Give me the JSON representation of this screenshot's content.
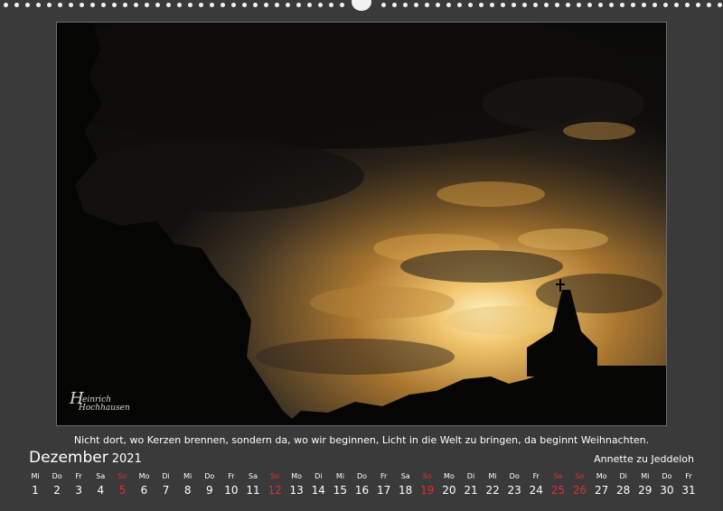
{
  "calendar": {
    "month_name": "Dezember",
    "year": "2021",
    "quote": "Nicht dort, wo Kerzen brennen, sondern da, wo wir beginnen, Licht in die Welt zu bringen, da beginnt Weihnachten.",
    "author": "Annette zu Jeddeloh",
    "signature": {
      "initial": "H",
      "line1": "einrich",
      "line2": "Hochhausen"
    },
    "days": [
      {
        "wd": "Mi",
        "d": "1",
        "red": false
      },
      {
        "wd": "Do",
        "d": "2",
        "red": false
      },
      {
        "wd": "Fr",
        "d": "3",
        "red": false
      },
      {
        "wd": "Sa",
        "d": "4",
        "red": false
      },
      {
        "wd": "So",
        "d": "5",
        "red": true
      },
      {
        "wd": "Mo",
        "d": "6",
        "red": false
      },
      {
        "wd": "Di",
        "d": "7",
        "red": false
      },
      {
        "wd": "Mi",
        "d": "8",
        "red": false
      },
      {
        "wd": "Do",
        "d": "9",
        "red": false
      },
      {
        "wd": "Fr",
        "d": "10",
        "red": false
      },
      {
        "wd": "Sa",
        "d": "11",
        "red": false
      },
      {
        "wd": "So",
        "d": "12",
        "red": true
      },
      {
        "wd": "Mo",
        "d": "13",
        "red": false
      },
      {
        "wd": "Di",
        "d": "14",
        "red": false
      },
      {
        "wd": "Mi",
        "d": "15",
        "red": false
      },
      {
        "wd": "Do",
        "d": "16",
        "red": false
      },
      {
        "wd": "Fr",
        "d": "17",
        "red": false
      },
      {
        "wd": "Sa",
        "d": "18",
        "red": false
      },
      {
        "wd": "So",
        "d": "19",
        "red": true
      },
      {
        "wd": "Mo",
        "d": "20",
        "red": false
      },
      {
        "wd": "Di",
        "d": "21",
        "red": false
      },
      {
        "wd": "Mi",
        "d": "22",
        "red": false
      },
      {
        "wd": "Do",
        "d": "23",
        "red": false
      },
      {
        "wd": "Fr",
        "d": "24",
        "red": false
      },
      {
        "wd": "Sa",
        "d": "25",
        "red": true
      },
      {
        "wd": "So",
        "d": "26",
        "red": true
      },
      {
        "wd": "Mo",
        "d": "27",
        "red": false
      },
      {
        "wd": "Di",
        "d": "28",
        "red": false
      },
      {
        "wd": "Mi",
        "d": "29",
        "red": false
      },
      {
        "wd": "Do",
        "d": "30",
        "red": false
      },
      {
        "wd": "Fr",
        "d": "31",
        "red": false
      }
    ]
  },
  "colors": {
    "background": "#3a3a3a",
    "text": "#ffffff",
    "holiday_red": "#e0312b",
    "sky_gold": "#d9a34a"
  },
  "icons": {
    "hanger": "wire-binding-hanger",
    "holes": "binding-hole"
  }
}
